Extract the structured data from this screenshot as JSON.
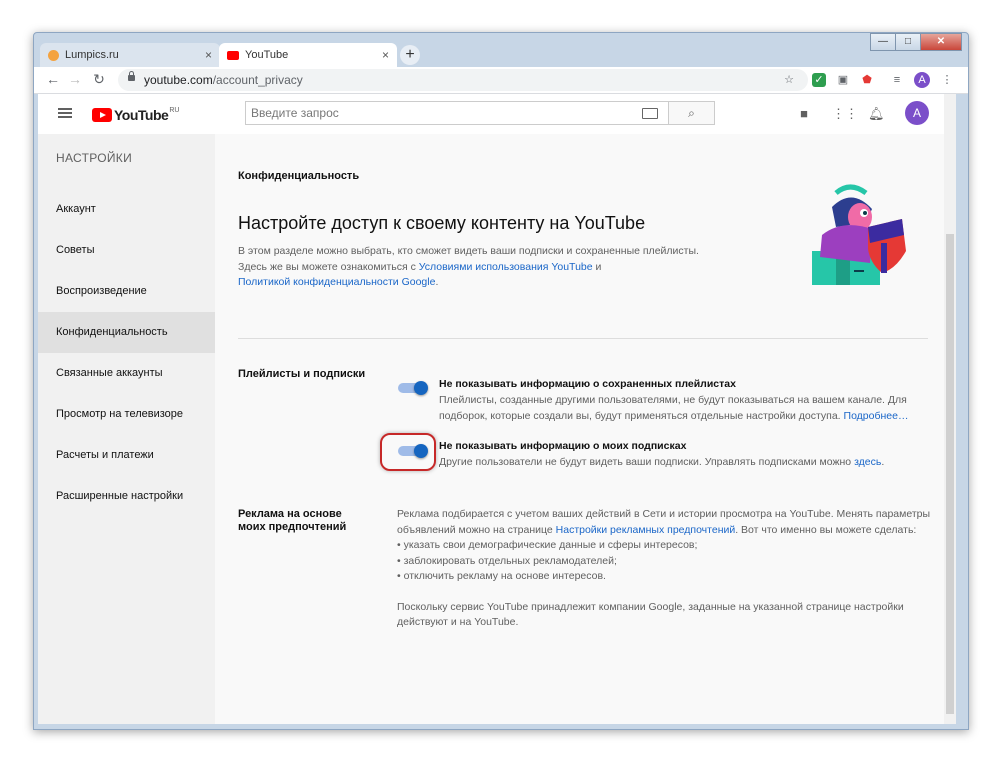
{
  "browser": {
    "tabs": [
      {
        "title": "Lumpics.ru",
        "close": "×"
      },
      {
        "title": "YouTube",
        "close": "×"
      }
    ],
    "new_tab": "+",
    "url_host": "youtube.com",
    "url_path": "/account_privacy",
    "window_buttons": {
      "minimize": "—",
      "maximize": "□",
      "close": "✕"
    },
    "profile_letter": "A"
  },
  "youtube": {
    "logo_text": "YouTube",
    "logo_region": "RU",
    "search_placeholder": "Введите запрос",
    "avatar_letter": "A"
  },
  "sidebar": {
    "heading": "НАСТРОЙКИ",
    "items": [
      {
        "label": "Аккаунт"
      },
      {
        "label": "Советы"
      },
      {
        "label": "Воспроизведение"
      },
      {
        "label": "Конфиденциальность"
      },
      {
        "label": "Связанные аккаунты"
      },
      {
        "label": "Просмотр на телевизоре"
      },
      {
        "label": "Расчеты и платежи"
      },
      {
        "label": "Расширенные настройки"
      }
    ]
  },
  "main": {
    "section_title": "Конфиденциальность",
    "headline": "Настройте доступ к своему контенту на YouTube",
    "intro_line1": "В этом разделе можно выбрать, кто сможет видеть ваши подписки и сохраненные плейлисты.",
    "intro_line2_pre": "Здесь же вы можете ознакомиться с",
    "intro_link_terms": "Условиями использования YouTube",
    "intro_line2_post": "и",
    "intro_link_privacy": "Политикой конфиденциальности Google",
    "intro_end": ".",
    "playlists": {
      "label": "Плейлисты и подписки",
      "option1_title": "Не показывать информацию о сохраненных плейлистах",
      "option1_desc1": "Плейлисты, созданные другими пользователями, не будут показываться на вашем канале. Для",
      "option1_desc2": "подборок, которые создали вы, будут применяться отдельные настройки доступа.",
      "option1_link": "Подробнее…",
      "option1_on": true,
      "option2_title": "Не показывать информацию о моих подписках",
      "option2_desc": "Другие пользователи не будут видеть ваши подписки. Управлять подписками можно",
      "option2_link": "здесь",
      "option2_end": ".",
      "option2_on": true
    },
    "ads": {
      "label_line1": "Реклама на основе",
      "label_line2": "моих предпочтений",
      "text1": "Реклама подбирается с учетом ваших действий в Сети и истории просмотра на YouTube. Менять параметры",
      "text2_pre": "объявлений можно на странице",
      "text2_link": "Настройки рекламных предпочтений",
      "text2_post": ". Вот что именно вы можете сделать:",
      "bullets": [
        "• указать свои демографические данные и сферы интересов;",
        "• заблокировать отдельных рекламодателей;",
        "• отключить рекламу на основе интересов."
      ],
      "footer1": "Поскольку сервис YouTube принадлежит компании Google, заданные на указанной странице настройки",
      "footer2": "действуют и на YouTube."
    }
  }
}
